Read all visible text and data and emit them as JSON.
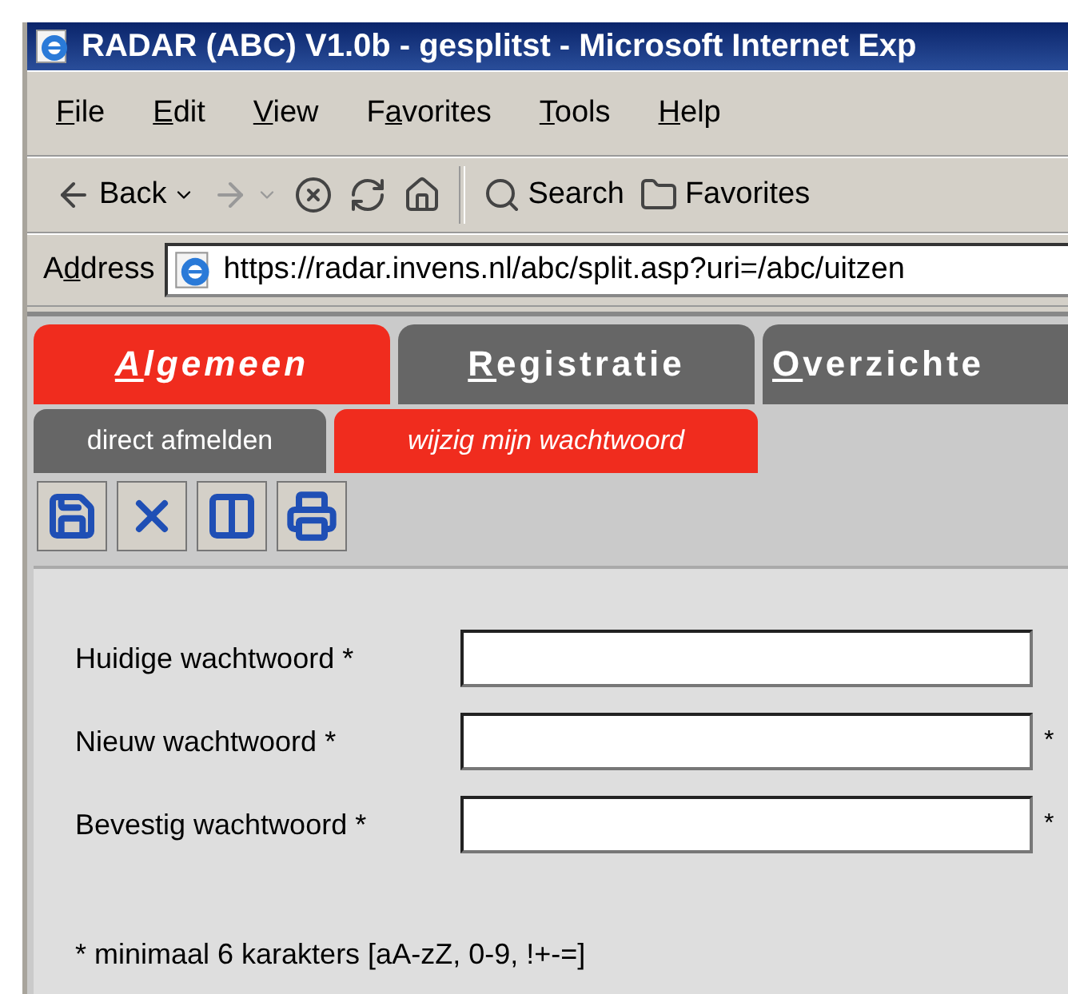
{
  "window": {
    "title": "RADAR (ABC) V1.0b - gesplitst - Microsoft Internet Exp"
  },
  "menu": [
    {
      "key": "F",
      "post": "ile"
    },
    {
      "key": "E",
      "post": "dit"
    },
    {
      "key": "V",
      "post": "iew"
    },
    {
      "pre": "F",
      "key": "a",
      "post": "vorites"
    },
    {
      "key": "T",
      "post": "ools"
    },
    {
      "key": "H",
      "post": "elp"
    }
  ],
  "toolbar": [
    {
      "kind": "back",
      "label": "Back",
      "disabled": false
    },
    {
      "kind": "forward",
      "disabled": true
    },
    {
      "kind": "stop",
      "disabled": false
    },
    {
      "kind": "refresh",
      "disabled": false
    },
    {
      "kind": "home",
      "disabled": false
    },
    {
      "kind": "search",
      "label": "Search",
      "disabled": false
    },
    {
      "kind": "favorites",
      "label": "Favorites",
      "disabled": false
    }
  ],
  "address": {
    "label": {
      "pre": "A",
      "key": "d",
      "post": "dress"
    },
    "value": "https://radar.invens.nl/abc/split.asp?uri=/abc/uitzen"
  },
  "tabs": [
    {
      "label": {
        "key": "A",
        "post": "lgemeen"
      },
      "selected": true
    },
    {
      "label": {
        "key": "R",
        "post": "egistratie"
      },
      "selected": false
    },
    {
      "label": {
        "key": "O",
        "post": "verzichte"
      },
      "selected": false
    }
  ],
  "subtabs": [
    {
      "label": "direct afmelden",
      "selected": false
    },
    {
      "label": "wijzig mijn wachtwoord",
      "selected": true
    }
  ],
  "actions": [
    {
      "kind": "save"
    },
    {
      "kind": "delete"
    },
    {
      "kind": "split"
    },
    {
      "kind": "print"
    }
  ],
  "form": {
    "fields": [
      {
        "label": "Huidige wachtwoord *"
      },
      {
        "label": "Nieuw wachtwoord *",
        "note": "*"
      },
      {
        "label": "Bevestig wachtwoord *",
        "note": "*"
      }
    ],
    "footnote": "* minimaal 6 karakters [aA-zZ, 0-9, !+-=]"
  }
}
